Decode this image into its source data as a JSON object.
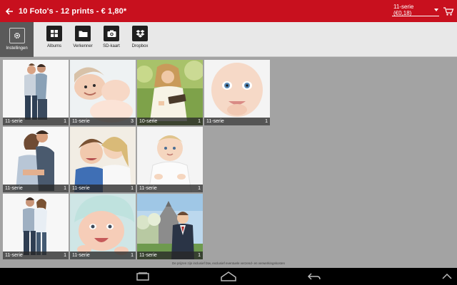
{
  "header": {
    "title": "10 Foto's - 12 prints - € 1,80*",
    "series_select": "11-serie (€0,18)"
  },
  "toolbar": {
    "settings_label": "Instellingen",
    "albums_label": "Albums",
    "explorer_label": "Verkenner",
    "sd_label": "SD-kaart",
    "dropbox_label": "Dropbox"
  },
  "photos": [
    {
      "series": "11-serie",
      "count": "1"
    },
    {
      "series": "11-serie",
      "count": "3"
    },
    {
      "series": "10-serie",
      "count": "1"
    },
    {
      "series": "11-serie",
      "count": "1"
    },
    {
      "series": "11-serie",
      "count": "1"
    },
    {
      "series": "11-serie",
      "count": "1"
    },
    {
      "series": "11-serie",
      "count": "1"
    },
    {
      "series": "11-serie",
      "count": "1"
    },
    {
      "series": "11-serie",
      "count": "1"
    },
    {
      "series": "11-serie",
      "count": "1"
    }
  ],
  "footnote": "De prijzen zijn inclusief btw, exclusief eventuele verzend- en verwerkingskosten",
  "colors": {
    "accent": "#c8101e",
    "caption": "#2a2a2a"
  }
}
